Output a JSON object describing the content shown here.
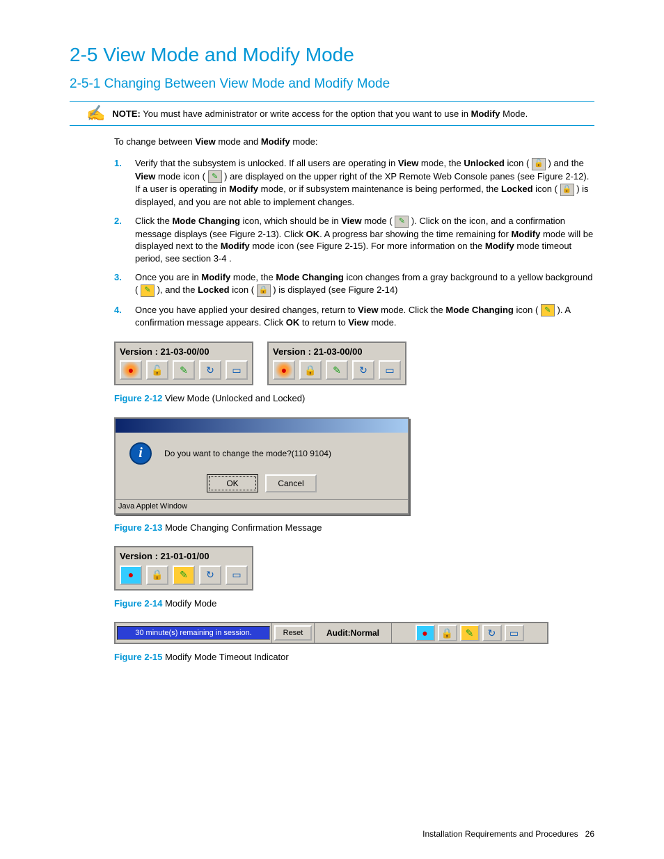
{
  "heading": "2-5 View Mode and Modify Mode",
  "subheading": "2-5-1 Changing Between View Mode and Modify Mode",
  "note": {
    "label": "NOTE:",
    "text_before": " You must have administrator or write access for the option that you want to use in ",
    "bold": "Modify",
    "text_after": " Mode."
  },
  "intro": {
    "a": "To change between ",
    "b": "View",
    "c": " mode and ",
    "d": "Modify",
    "e": " mode:"
  },
  "steps": {
    "s1": {
      "num": "1.",
      "p1": "Verify that the subsystem is unlocked. If all users are operating in ",
      "p1b1": "View",
      "p2": " mode, the ",
      "p2b1": "Unlocked",
      "p3": " icon ( ",
      "p4": " ) and the ",
      "p4b1": "View",
      "p5": " mode icon ( ",
      "p6": " ) are displayed on the upper right of the XP Remote Web Console panes (see Figure 2-12). If a user is operating in ",
      "p6b1": "Modify",
      "p7": " mode, or if subsystem maintenance is being performed, the ",
      "p7b1": "Locked",
      "p8": " icon ( ",
      "p9": " ) is displayed, and you are not able to implement changes."
    },
    "s2": {
      "num": "2.",
      "p1": "Click the ",
      "p1b1": "Mode Changing",
      "p2": " icon, which should be in ",
      "p2b1": "View",
      "p3": " mode ( ",
      "p4": " ). Click on the icon, and a confirmation message displays (see Figure 2-13). Click ",
      "p4b1": "OK",
      "p5": ". A progress bar showing the time remaining for ",
      "p5b1": "Modify",
      "p6": " mode will be displayed next to the ",
      "p6b1": "Modify",
      "p7": " mode icon (see Figure 2-15). For more information on the ",
      "p7b1": "Modify",
      "p8": " mode timeout period, see section 3-4 ."
    },
    "s3": {
      "num": "3.",
      "p1": "Once you are in ",
      "p1b1": "Modify",
      "p2": " mode, the ",
      "p2b1": "Mode Changing",
      "p3": " icon changes from a gray background to a yellow background ( ",
      "p4": " ), and the ",
      "p4b1": "Locked",
      "p5": " icon ( ",
      "p6": " ) is displayed (see Figure 2-14)"
    },
    "s4": {
      "num": "4.",
      "p1": "Once you have applied your desired changes, return to ",
      "p1b1": "View",
      "p2": " mode. Click the ",
      "p2b1": "Mode Changing",
      "p3": " icon ( ",
      "p4": " ). A confirmation message appears. Click ",
      "p4b1": "OK",
      "p5": " to return to ",
      "p5b1": "View",
      "p6": " mode."
    }
  },
  "fig12": {
    "version_a": "Version : 21-03-00/00",
    "version_b": "Version : 21-03-00/00",
    "label": "Figure 2-12",
    "caption": " View Mode (Unlocked and Locked)"
  },
  "fig13": {
    "message": "Do you want to change the mode?(110 9104)",
    "ok": "OK",
    "cancel": "Cancel",
    "status": "Java Applet Window",
    "label": "Figure 2-13",
    "caption": " Mode Changing Confirmation Message"
  },
  "fig14": {
    "version": "Version : 21-01-01/00",
    "label": "Figure 2-14",
    "caption": " Modify Mode"
  },
  "fig15": {
    "progress": "30 minute(s) remaining in session.",
    "reset": "Reset",
    "audit": "Audit:Normal",
    "label": "Figure 2-15",
    "caption": " Modify Mode Timeout Indicator"
  },
  "footer": {
    "text": "Installation Requirements and Procedures",
    "page": "26"
  }
}
